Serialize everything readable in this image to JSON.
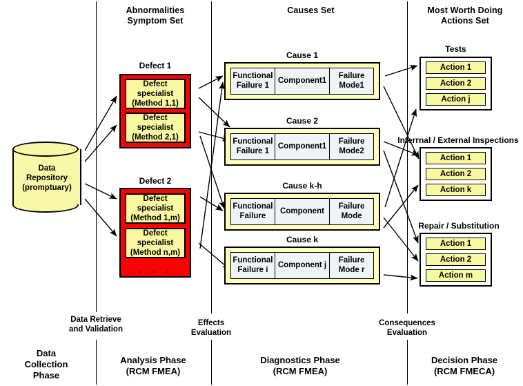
{
  "columns": {
    "headers": [
      {
        "id": "abnormalities",
        "text": "Abnormalities\nSymptom Set",
        "line1": "Abnormalities",
        "line2": "Symptom Set"
      },
      {
        "id": "causes",
        "text": "Causes Set",
        "line1": "Causes Set",
        "line2": ""
      },
      {
        "id": "actions",
        "text": "Most Worth Doing Actions Set",
        "line1": "Most Worth Doing",
        "line2": "Actions Set"
      }
    ]
  },
  "repository": {
    "line1": "Data",
    "line2": "Repository",
    "line3": "(promptuary)"
  },
  "defects": [
    {
      "title": "Defect 1",
      "specialists": [
        {
          "line1": "Defect specialist",
          "line2": "(Method 1,1)"
        },
        {
          "line1": "Defect specialist",
          "line2": "(Method 2,1)"
        }
      ],
      "ellipsis": ""
    },
    {
      "title": "Defect 2",
      "specialists": [
        {
          "line1": "Defect specialist",
          "line2": "(Method 1,m)"
        },
        {
          "line1": "Defect specialist",
          "line2": "(Method n,m)"
        }
      ],
      "ellipsis": ". . ."
    }
  ],
  "causes": [
    {
      "title": "Cause 1",
      "cells": [
        {
          "line1": "Functional",
          "line2": "Failure 1"
        },
        {
          "line1": "Component1",
          "line2": ""
        },
        {
          "line1": "Failure",
          "line2": "Mode1"
        }
      ]
    },
    {
      "title": "Cause 2",
      "cells": [
        {
          "line1": "Functional",
          "line2": "Failure 1"
        },
        {
          "line1": "Component1",
          "line2": ""
        },
        {
          "line1": "Failure",
          "line2": "Mode2"
        }
      ]
    },
    {
      "title": "Cause k-h",
      "cells": [
        {
          "line1": "Functional",
          "line2": "Failure"
        },
        {
          "line1": "Component",
          "line2": ""
        },
        {
          "line1": "Failure",
          "line2": "Mode"
        }
      ]
    },
    {
      "title": "Cause k",
      "cells": [
        {
          "line1": "Functional",
          "line2": "Failure i"
        },
        {
          "line1": "Component j",
          "line2": ""
        },
        {
          "line1": "Failure",
          "line2": "Mode r"
        }
      ]
    }
  ],
  "action_groups": [
    {
      "title": "Tests",
      "actions": [
        "Action 1",
        "Action 2",
        "Action j"
      ]
    },
    {
      "title": "Interrnal / External Inspections",
      "actions": [
        "Action 1",
        "Action 2",
        "Action k"
      ]
    },
    {
      "title": "Repair / Substitution",
      "actions": [
        "Action 1",
        "Action 2",
        "Action m"
      ]
    }
  ],
  "boundary_labels": [
    {
      "line1": "Data Retrieve",
      "line2": "and Validation"
    },
    {
      "line1": "Effects",
      "line2": "Evaluation"
    },
    {
      "line1": "Consequences",
      "line2": "Evaluation"
    }
  ],
  "phases": [
    {
      "line1": "Data",
      "line2": "Collection",
      "line3": "Phase"
    },
    {
      "line1": "Analysis Phase",
      "line2": "(RCM  FMEA)",
      "line3": ""
    },
    {
      "line1": "Diagnostics Phase",
      "line2": "(RCM  FMEA)",
      "line3": ""
    },
    {
      "line1": "Decision Phase",
      "line2": "(RCM  FMECA)",
      "line3": ""
    }
  ],
  "colors": {
    "defect_red": "#fc0000",
    "pale_yellow": "#f8f8a0",
    "cause_yellow": "#ffffbb",
    "cause_cell_blue": "#eef4f8",
    "line_black": "#000000"
  }
}
